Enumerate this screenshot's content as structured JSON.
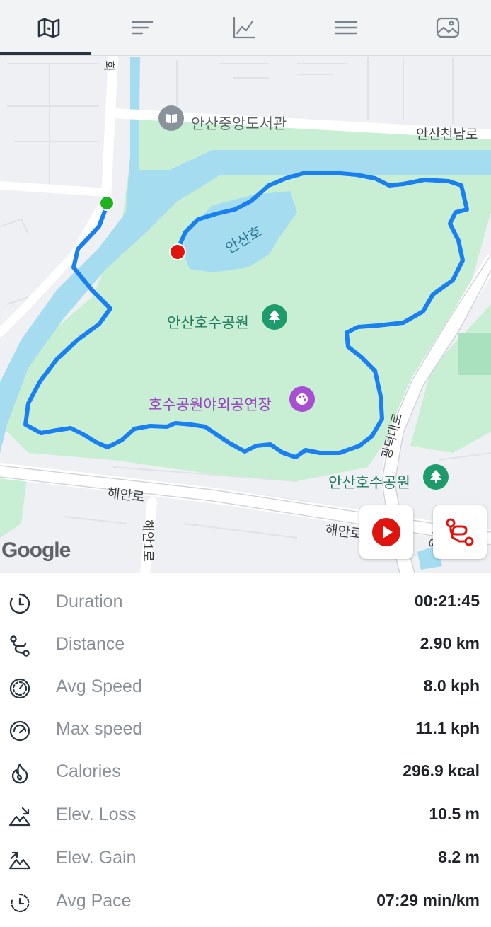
{
  "tabs": [
    {
      "name": "map-icon"
    },
    {
      "name": "laps-icon"
    },
    {
      "name": "chart-icon"
    },
    {
      "name": "menu-icon"
    },
    {
      "name": "photo-icon"
    }
  ],
  "map": {
    "labels": {
      "library": "안산중앙도서관",
      "road_cheonnam": "안산천남로",
      "lake": "안산호",
      "park": "안산호수공원",
      "theater": "호수공원야외공연장",
      "road_gwangdeok": "광덕대로",
      "park2": "안산호수공원",
      "road_haean": "해안로",
      "road_haean2": "해안로",
      "road_top": "화",
      "road_vertical": "해안1로",
      "road_yong": "용신"
    },
    "attribution": "Google",
    "colors": {
      "route": "#1a7ff0",
      "park": "#c8efd4",
      "water": "#a6dcf0",
      "start": "#1fb31f",
      "end": "#e0140e"
    }
  },
  "stats": [
    {
      "icon": "clock-icon",
      "label": "Duration",
      "value": "00:21:45"
    },
    {
      "icon": "route-icon",
      "label": "Distance",
      "value": "2.90 km"
    },
    {
      "icon": "speedometer-icon",
      "label": "Avg Speed",
      "value": "8.0 kph"
    },
    {
      "icon": "max-speedometer-icon",
      "label": "Max speed",
      "value": "11.1 kph"
    },
    {
      "icon": "flame-icon",
      "label": "Calories",
      "value": "296.9 kcal"
    },
    {
      "icon": "elevation-loss-icon",
      "label": "Elev. Loss",
      "value": "10.5 m"
    },
    {
      "icon": "elevation-gain-icon",
      "label": "Elev. Gain",
      "value": "8.2 m"
    },
    {
      "icon": "pace-icon",
      "label": "Avg Pace",
      "value": "07:29 min/km"
    }
  ]
}
